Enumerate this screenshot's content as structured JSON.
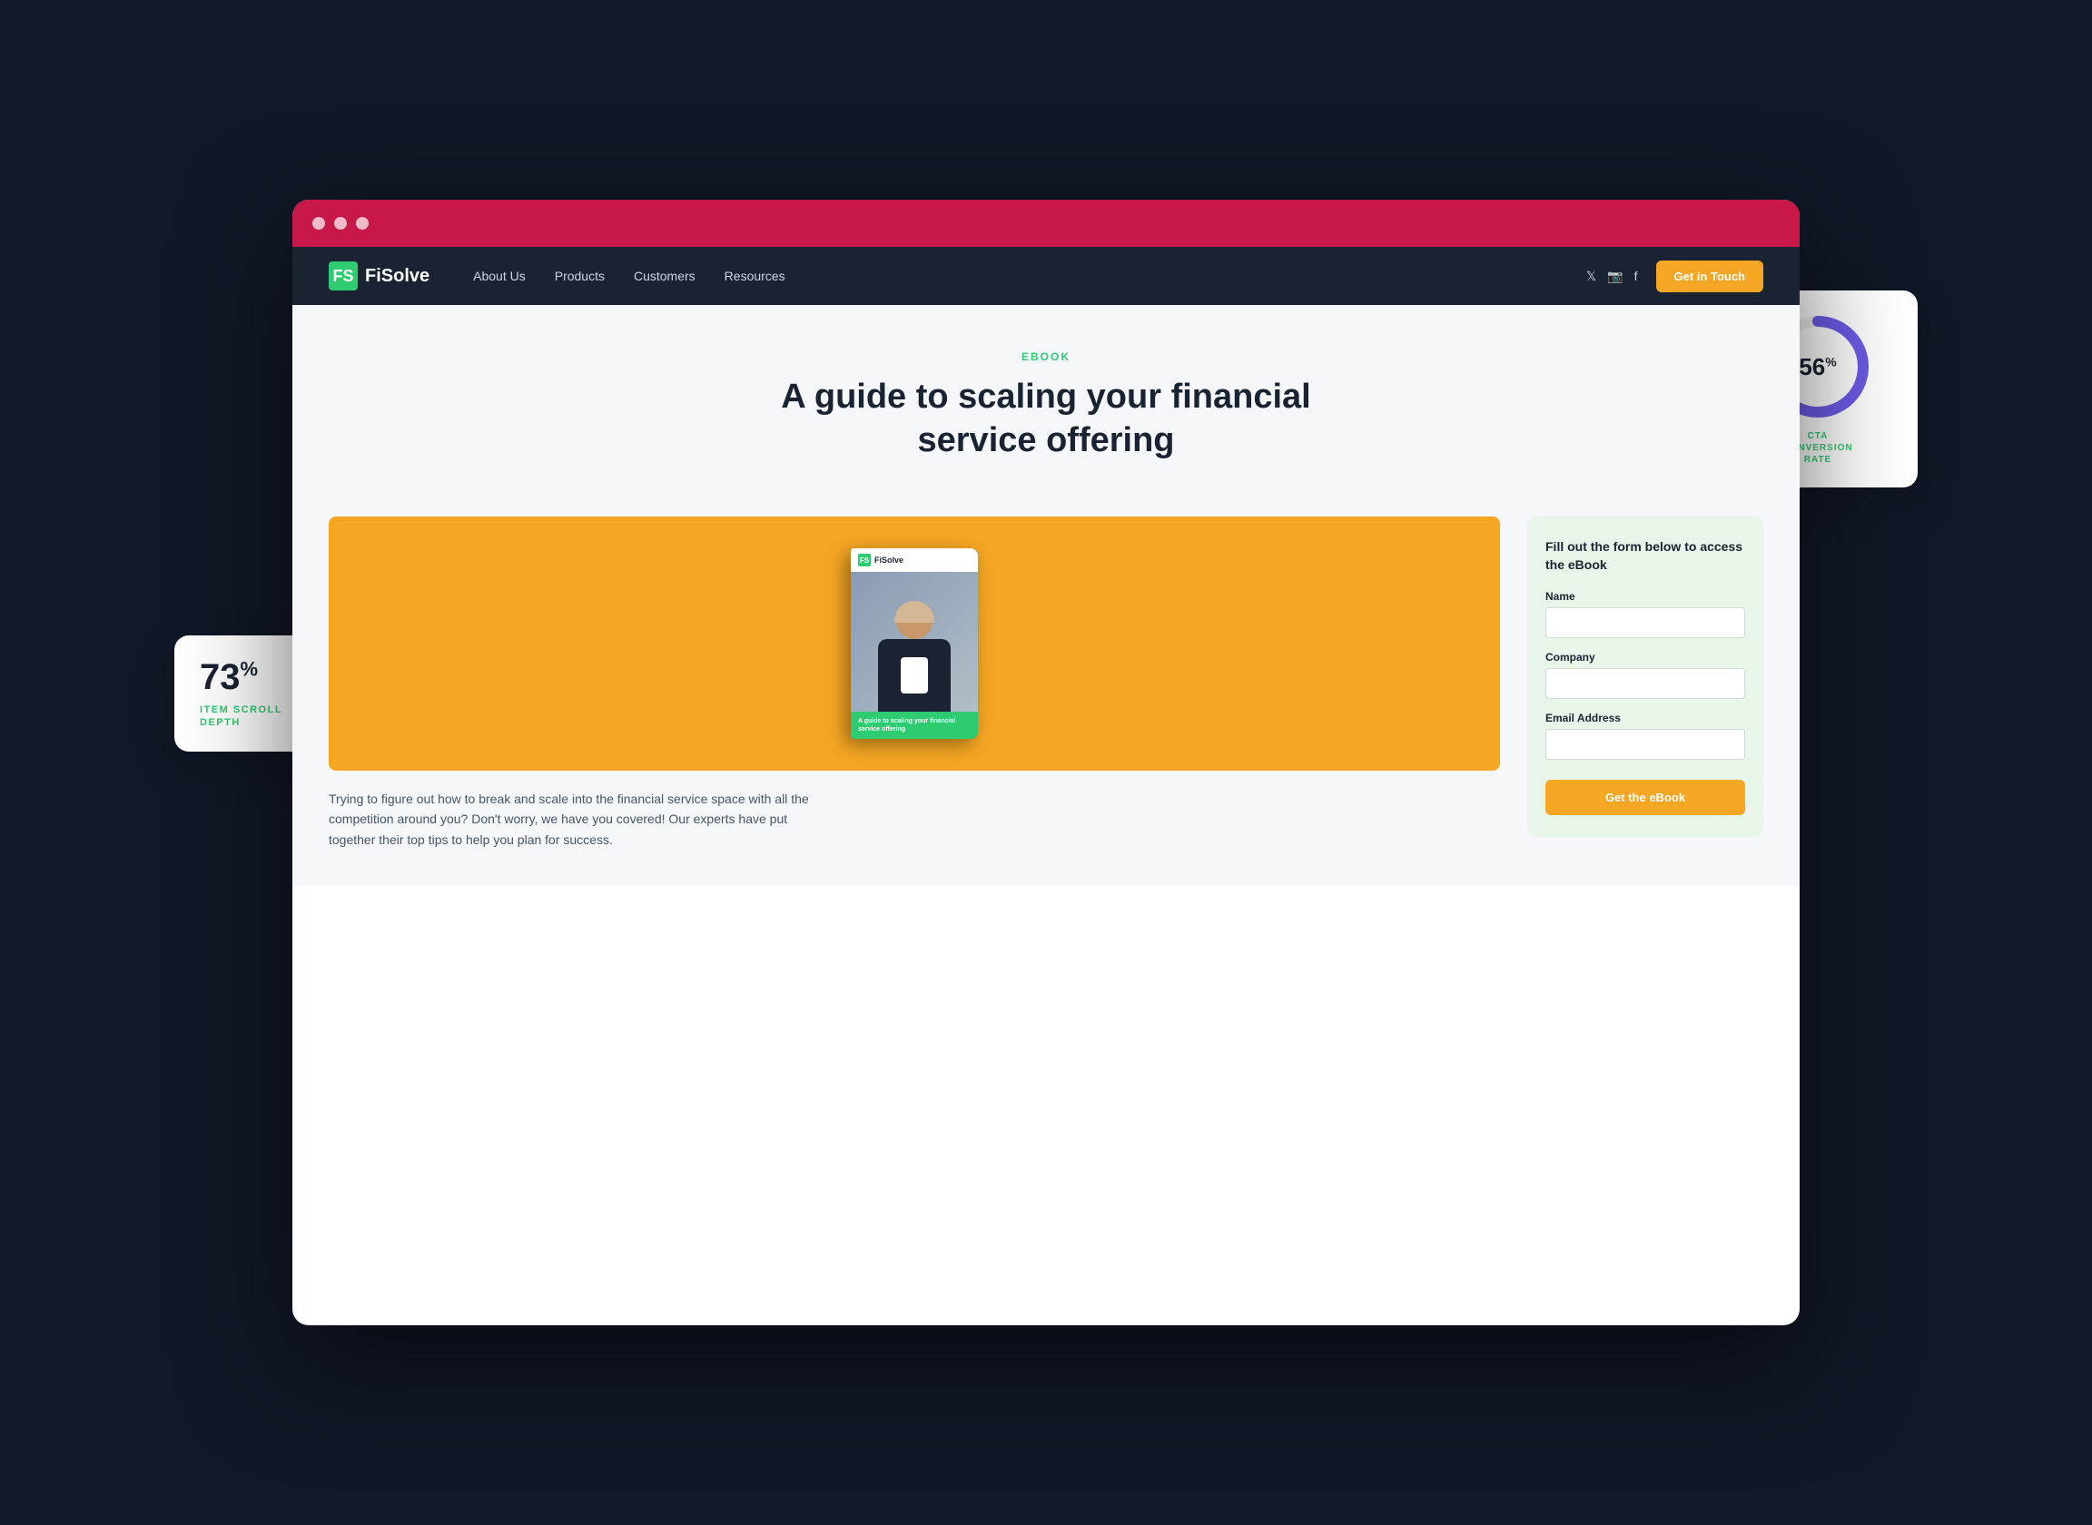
{
  "browser": {
    "dots": [
      "dot1",
      "dot2",
      "dot3"
    ]
  },
  "navbar": {
    "logo_icon": "FS",
    "logo_text": "FiSolve",
    "nav_links": [
      {
        "label": "About Us"
      },
      {
        "label": "Products"
      },
      {
        "label": "Customers"
      },
      {
        "label": "Resources"
      }
    ],
    "cta_button": "Get in Touch"
  },
  "hero": {
    "badge": "EBOOK",
    "title": "A guide to scaling your financial service offering"
  },
  "book": {
    "logo_text": "FiSolve",
    "footer_text": "A guide to scaling your financial service offering"
  },
  "form": {
    "intro": "Fill out the form below to access the eBook",
    "name_label": "Name",
    "name_placeholder": "",
    "company_label": "Company",
    "company_placeholder": "",
    "email_label": "Email Address",
    "email_placeholder": "",
    "submit_button": "Get the eBook"
  },
  "description": "Trying to figure out how to break and scale into the financial service space with all the competition around you? Don't worry, we have you covered! Our experts have put together their top tips to help you plan for success.",
  "stat_left": {
    "value": "73",
    "suffix": "%",
    "label": "ITEM SCROLL\nDEPTH"
  },
  "stat_right": {
    "value": "56",
    "suffix": "%",
    "label": "CTA\nCONVERSION\nRATE",
    "donut_percent": 56
  }
}
